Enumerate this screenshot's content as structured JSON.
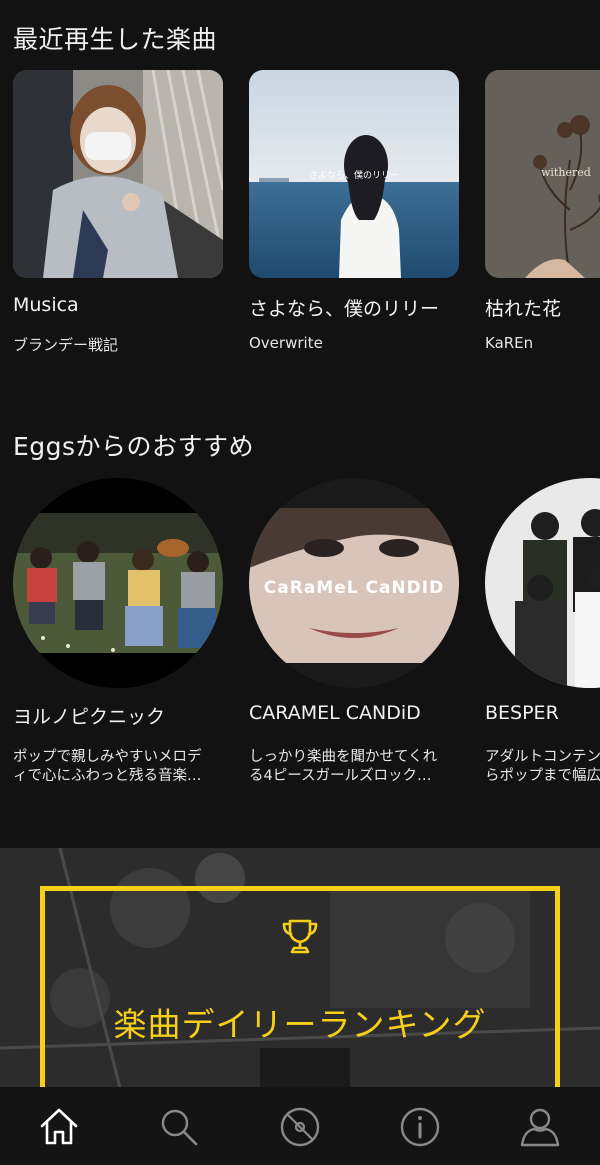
{
  "sections": {
    "recent_title": "最近再生した楽曲",
    "recommend_title": "Eggsからのおすすめ"
  },
  "recent": [
    {
      "title": "Musica",
      "artist": "ブランデー戦記"
    },
    {
      "title": "さよなら、僕のリリー",
      "artist": "Overwrite"
    },
    {
      "title": "枯れた花",
      "artist": "KaREn"
    }
  ],
  "recent_art_text": {
    "lily": "さよなら、僕のリリー",
    "withered": "withered"
  },
  "recommend": [
    {
      "name": "ヨルノピクニック",
      "desc1": "ポップで親しみやすいメロデ",
      "desc2": "ィで心にふわっと残る音楽…"
    },
    {
      "name": "CARAMEL CANDiD",
      "desc1": "しっかり楽曲を聞かせてくれ",
      "desc2": "る4ピースガールズロック…"
    },
    {
      "name": "BESPER",
      "desc1": "アダルトコンテンポラリーか",
      "desc2": "らポップまで幅広く…"
    }
  ],
  "recommend_art_text": {
    "caramel": "CaRaMeL CaNDID"
  },
  "banner": {
    "label": "楽曲デイリーランキング",
    "accent": "#f6cf18"
  },
  "tabs": [
    {
      "name": "home",
      "icon": "home-icon",
      "active": true
    },
    {
      "name": "search",
      "icon": "search-icon",
      "active": false
    },
    {
      "name": "library",
      "icon": "disc-icon",
      "active": false
    },
    {
      "name": "info",
      "icon": "info-icon",
      "active": false
    },
    {
      "name": "account",
      "icon": "user-icon",
      "active": false
    }
  ]
}
